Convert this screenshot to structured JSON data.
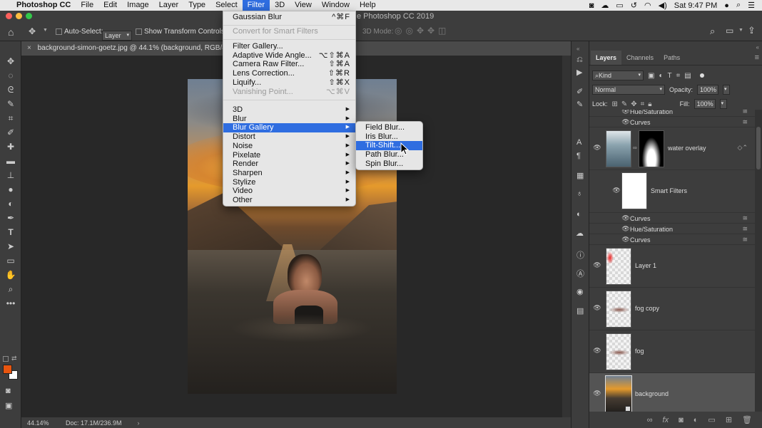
{
  "menubar": {
    "items": [
      "File",
      "Edit",
      "Image",
      "Layer",
      "Type",
      "Select",
      "Filter",
      "3D",
      "View",
      "Window",
      "Help"
    ],
    "app": "Photoshop CC",
    "clock": "Sat 9:47 PM"
  },
  "title": {
    "window_title": "Adobe Photoshop CC 2019",
    "visible_fragment": "e Photoshop CC 2019"
  },
  "options": {
    "auto_select_label": "Auto-Select:",
    "auto_select_value": "Layer",
    "show_transform_label": "Show Transform Controls",
    "mode_3d": "3D Mode:"
  },
  "document": {
    "tab_title": "background-simon-goetz.jpg @ 44.1% (background, RGB/8) *",
    "zoom": "44.14%",
    "doc_size": "Doc: 17.1M/236.9M"
  },
  "filter_menu": {
    "items": [
      {
        "label": "Gaussian Blur",
        "shortcut": "^⌘F"
      },
      {
        "label": "Convert for Smart Filters",
        "disabled": true
      },
      {
        "label": "Filter Gallery..."
      },
      {
        "label": "Adaptive Wide Angle...",
        "shortcut": "⌥⇧⌘A"
      },
      {
        "label": "Camera Raw Filter...",
        "shortcut": "⇧⌘A"
      },
      {
        "label": "Lens Correction...",
        "shortcut": "⇧⌘R"
      },
      {
        "label": "Liquify...",
        "shortcut": "⇧⌘X"
      },
      {
        "label": "Vanishing Point...",
        "shortcut": "⌥⌘V",
        "disabled": true
      },
      {
        "label": "3D",
        "submenu": true
      },
      {
        "label": "Blur",
        "submenu": true
      },
      {
        "label": "Blur Gallery",
        "submenu": true,
        "highlighted": true
      },
      {
        "label": "Distort",
        "submenu": true
      },
      {
        "label": "Noise",
        "submenu": true
      },
      {
        "label": "Pixelate",
        "submenu": true
      },
      {
        "label": "Render",
        "submenu": true
      },
      {
        "label": "Sharpen",
        "submenu": true
      },
      {
        "label": "Stylize",
        "submenu": true
      },
      {
        "label": "Video",
        "submenu": true
      },
      {
        "label": "Other",
        "submenu": true
      }
    ]
  },
  "blur_gallery_submenu": {
    "items": [
      {
        "label": "Field Blur..."
      },
      {
        "label": "Iris Blur..."
      },
      {
        "label": "Tilt-Shift...",
        "highlighted": true
      },
      {
        "label": "Path Blur..."
      },
      {
        "label": "Spin Blur..."
      }
    ]
  },
  "layers_panel": {
    "tabs": [
      "Layers",
      "Channels",
      "Paths"
    ],
    "active_tab": "Layers",
    "filter_kind": "Kind",
    "blend_mode": "Normal",
    "opacity_label": "Opacity:",
    "opacity": "100%",
    "lock_label": "Lock:",
    "fill_label": "Fill:",
    "fill": "100%",
    "layers": [
      {
        "name": "Hue/Saturation",
        "type": "filter"
      },
      {
        "name": "Curves",
        "type": "filter"
      },
      {
        "name": "water overlay",
        "type": "smart-object-with-mask"
      },
      {
        "name": "Smart Filters",
        "type": "smart-filters"
      },
      {
        "name": "Curves",
        "type": "filter"
      },
      {
        "name": "Hue/Saturation",
        "type": "filter"
      },
      {
        "name": "Curves",
        "type": "filter"
      },
      {
        "name": "Layer 1",
        "type": "layer"
      },
      {
        "name": "fog copy",
        "type": "layer"
      },
      {
        "name": "fog",
        "type": "layer"
      },
      {
        "name": "background",
        "type": "smart-object",
        "selected": true
      }
    ]
  },
  "colors": {
    "accent": "#2f6de0",
    "foreground": "#e8550f",
    "background": "#ffffff"
  }
}
